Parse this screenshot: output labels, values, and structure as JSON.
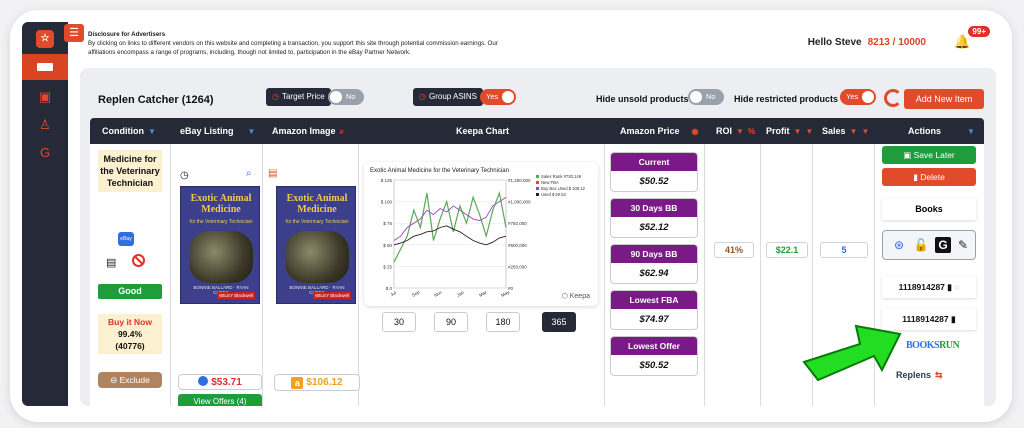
{
  "header": {
    "disclosure_title": "Disclosure for Advertisers",
    "disclosure_text": "By clicking on links to different vendors on this website and completing a transaction, you support this site through potential commission earnings. Our affiliations encompass a range of programs, including, though not limited to, participation in the eBay Partner Network.",
    "greeting": "Hello Steve",
    "counter": "8213 / 10000",
    "notif_badge": "99+"
  },
  "toolbar": {
    "title": "Replen Catcher (1264)",
    "target_price_label": "Target Price",
    "target_price_toggle": "No",
    "group_asins_label": "Group ASINS",
    "group_asins_toggle": "Yes",
    "hide_unsold_label": "Hide unsold products",
    "hide_unsold_toggle": "No",
    "hide_restricted_label": "Hide restricted products",
    "hide_restricted_toggle": "Yes",
    "add_new_item": "Add New Item"
  },
  "columns": {
    "condition": "Condition",
    "ebay_listing": "eBay Listing",
    "amazon_image": "Amazon Image",
    "keepa_chart": "Keepa Chart",
    "amazon_price": "Amazon Price",
    "roi": "ROI",
    "profit": "Profit",
    "sales": "Sales",
    "actions": "Actions"
  },
  "row": {
    "title": "Medicine for the Veterinary Technician",
    "ebay_chip": "eBay",
    "condition": "Good",
    "buy_label": "Buy it Now",
    "rating": "99.4%",
    "feedback": "(40776)",
    "exclude": "Exclude",
    "book_title": "Exotic Animal Medicine",
    "book_subtitle": "for the Veterinary Technician",
    "book_edition": "THIRD EDITION",
    "book_authors": "BONNIE BALLARD · RYAN CHEEK",
    "book_publisher": "WILEY Blackwell",
    "ebay_price": "$53.71",
    "view_offers": "View Offers (4)",
    "amazon_price": "$106.12",
    "keepa_title": "Exotic Animal Medicine for the Veterinary Technician",
    "keepa_brand": "Keepa",
    "keepa_ranges": [
      "30",
      "90",
      "180",
      "365"
    ],
    "prices": [
      {
        "label": "Current",
        "value": "$50.52"
      },
      {
        "label": "30 Days BB",
        "value": "$52.12"
      },
      {
        "label": "90 Days BB",
        "value": "$62.94"
      },
      {
        "label": "Lowest FBA",
        "value": "$74.97"
      },
      {
        "label": "Lowest Offer",
        "value": "$50.52"
      }
    ],
    "roi": "41%",
    "profit": "$22.1",
    "sales": "5",
    "save_later": "Save Later",
    "delete": "Delete",
    "category": "Books",
    "isbn_1": "1118914287",
    "isbn_2": "1118914287",
    "booksrun_a": "BOOKS",
    "booksrun_b": "RUN",
    "replens": "Replens"
  },
  "chart_data": {
    "type": "line",
    "title": "Exotic Animal Medicine for the Veterinary Technician",
    "x": [
      "Jul",
      "Sep",
      "Nov",
      "Jan",
      "Mar",
      "May"
    ],
    "y_left_ticks": [
      "$ 125",
      "$ 100",
      "$ 75",
      "$ 50",
      "$ 25",
      "$ 0"
    ],
    "y_right_ticks": [
      "#1,250,000",
      "#1,000,000",
      "#750,000",
      "#500,000",
      "#250,000",
      "#0"
    ],
    "legend": [
      "Sales Rank #730,149",
      "New FBA",
      "Buy Box Used $ 106.12",
      "Used $ 50.52"
    ],
    "series": [
      {
        "name": "Sales Rank #730,149",
        "values": [
          30,
          45,
          60,
          90,
          70,
          110,
          55,
          80,
          100,
          65,
          95,
          75,
          105,
          85,
          60,
          90,
          110,
          70
        ]
      },
      {
        "name": "Buy Box Used $ 106.12",
        "values": [
          55,
          60,
          70,
          75,
          80,
          90,
          85,
          92,
          88,
          95,
          90,
          85,
          80,
          78,
          82,
          95,
          100,
          105
        ]
      },
      {
        "name": "Used $ 50.52",
        "values": [
          50,
          52,
          55,
          60,
          62,
          65,
          66,
          70,
          72,
          68,
          65,
          60,
          55,
          52,
          50,
          53,
          58,
          60
        ]
      }
    ],
    "ylim": [
      0,
      125
    ]
  },
  "colors": {
    "accent": "#e24a2c",
    "dark": "#262a38",
    "purple": "#7a1a86",
    "green": "#1e9d3a"
  }
}
